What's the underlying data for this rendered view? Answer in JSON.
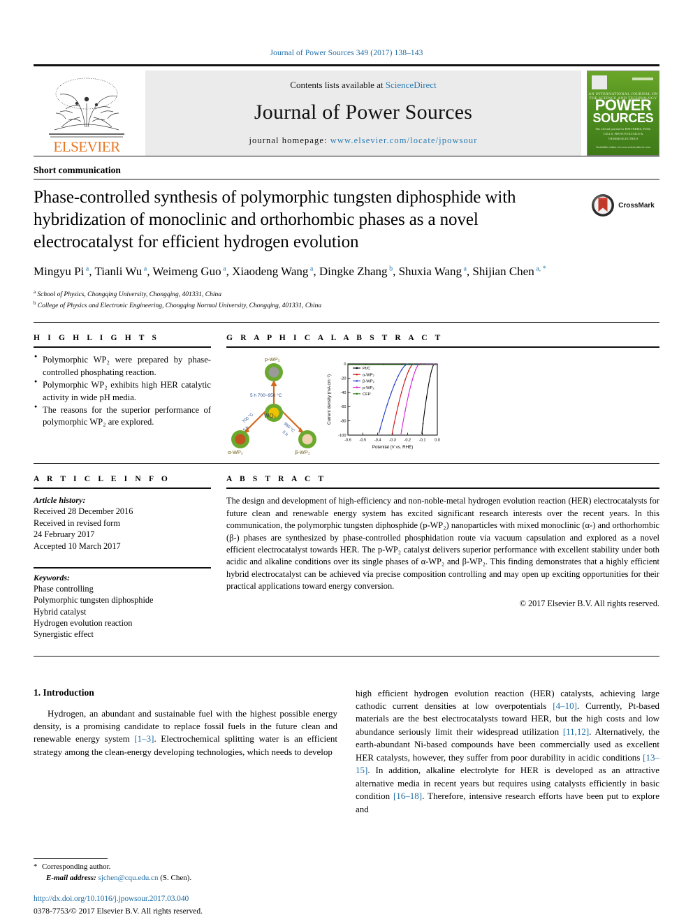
{
  "runhead": "Journal of Power Sources 349 (2017) 138–143",
  "masthead": {
    "contents_label": "Contents lists available at",
    "sciencedirect": "ScienceDirect",
    "journal_title": "Journal of Power Sources",
    "homepage_label": "journal homepage:",
    "homepage_url": "www.elsevier.com/locate/jpowsour",
    "publisher": "ELSEVIER",
    "cover": {
      "subtitle": "AN INTERNATIONAL JOURNAL ON THE SCIENCE AND TECHNOLOGY OF",
      "line1": "POWER",
      "line2": "SOURCES",
      "small": "The official journal for\nBATTERIES, FUEL CELLS, PHOTOVOLTAICS & THERMOELECTRICS",
      "bottom": "Available online at\nwww.sciencedirect.com"
    }
  },
  "article_type": "Short communication",
  "title": "Phase-controlled synthesis of polymorphic tungsten diphosphide with hybridization of monoclinic and orthorhombic phases as a novel electrocatalyst for efficient hydrogen evolution",
  "crossmark_label": "CrossMark",
  "authors": [
    {
      "name": "Mingyu Pi",
      "sup": "a",
      "sep": ", "
    },
    {
      "name": "Tianli Wu",
      "sup": "a",
      "sep": ", "
    },
    {
      "name": "Weimeng Guo",
      "sup": "a",
      "sep": ", "
    },
    {
      "name": "Xiaodeng Wang",
      "sup": "a",
      "sep": ", "
    },
    {
      "name": "Dingke Zhang",
      "sup": "b",
      "sep": ", "
    },
    {
      "name": "Shuxia Wang",
      "sup": "a",
      "sep": ", "
    },
    {
      "name": "Shijian Chen",
      "sup": "a, *",
      "sep": ""
    }
  ],
  "affiliations": [
    {
      "mark": "a",
      "text": "School of Physics, Chongqing University, Chongqing, 401331, China"
    },
    {
      "mark": "b",
      "text": "College of Physics and Electronic Engineering, Chongqing Normal University, Chongqing, 401331, China"
    }
  ],
  "highlights": {
    "heading": "H I G H L I G H T S",
    "items": [
      "Polymorphic WP₂ were prepared by phase-controlled phosphating reaction.",
      "Polymorphic WP₂ exhibits high HER catalytic activity in wide pH media.",
      "The reasons for the superior performance of polymorphic WP₂ are explored."
    ]
  },
  "graphical_abstract": {
    "heading": "G R A P H I C A L   A B S T R A C T",
    "diagram": {
      "center": "WO₃",
      "top_product": "p-WP₂",
      "left_product": "α-WP₂",
      "right_product": "β-WP₂",
      "top_condition": "5 h  700~950 °C",
      "left_condition": "700 °C",
      "left_time": "5 h",
      "right_condition": "950 °C",
      "right_time": "5 h"
    }
  },
  "chart_data": {
    "type": "line",
    "title": "",
    "xlabel": "Potential (V vs. RHE)",
    "ylabel": "Current density (mA cm⁻²)",
    "xlim": [
      -0.6,
      0.0
    ],
    "ylim": [
      -100,
      0
    ],
    "xticks": [
      "-0.6",
      "-0.5",
      "-0.4",
      "-0.3",
      "-0.2",
      "-0.1",
      "0.0"
    ],
    "yticks": [
      "0",
      "-20",
      "-40",
      "-60",
      "-80",
      "-100"
    ],
    "grid": false,
    "legend_position": "upper-left",
    "series": [
      {
        "name": "Pt/C",
        "color": "#000000",
        "onset": -0.02,
        "j100": -0.105
      },
      {
        "name": "α-WP₂",
        "color": "#cc1111",
        "onset": -0.16,
        "j100": -0.305
      },
      {
        "name": "β-WP₂",
        "color": "#1c39c4",
        "onset": -0.2,
        "j100": -0.395
      },
      {
        "name": "p-WP₂",
        "color": "#d81fd8",
        "onset": -0.12,
        "j100": -0.245
      },
      {
        "name": "CFP",
        "color": "#2d7a16",
        "onset": -0.6,
        "j100": 0.0
      }
    ]
  },
  "article_info": {
    "heading": "A R T I C L E   I N F O",
    "history_label": "Article history:",
    "history": [
      "Received 28 December 2016",
      "Received in revised form",
      "24 February 2017",
      "Accepted 10 March 2017"
    ],
    "keywords_label": "Keywords:",
    "keywords": [
      "Phase controlling",
      "Polymorphic tungsten diphosphide",
      "Hybrid catalyst",
      "Hydrogen evolution reaction",
      "Synergistic effect"
    ]
  },
  "abstract": {
    "heading": "A B S T R A C T",
    "text": "The design and development of high-efficiency and non-noble-metal hydrogen evolution reaction (HER) electrocatalysts for future clean and renewable energy system has excited significant research interests over the recent years. In this communication, the polymorphic tungsten diphosphide (p-WP₂) nanoparticles with mixed monoclinic (α-) and orthorhombic (β-) phases are synthesized by phase-controlled phosphidation route via vacuum capsulation and explored as a novel efficient electrocatalyst towards HER. The p-WP₂ catalyst delivers superior performance with excellent stability under both acidic and alkaline conditions over its single phases of α-WP₂ and β-WP₂. This finding demonstrates that a highly efficient hybrid electrocatalyst can be achieved via precise composition controlling and may open up exciting opportunities for their practical applications toward energy conversion.",
    "copyright": "© 2017 Elsevier B.V. All rights reserved."
  },
  "body": {
    "section_heading": "1.  Introduction",
    "left_paragraph_pre": "Hydrogen, an abundant and sustainable fuel with the highest possible energy density, is a promising candidate to replace fossil fuels in the future clean and renewable energy system ",
    "left_cite1": "[1–3]",
    "left_paragraph_post": ". Electrochemical splitting water is an efficient strategy among the clean-energy developing technologies, which needs to develop",
    "right_segments": [
      {
        "t": "high efficient hydrogen evolution reaction (HER) catalysts, achieving large cathodic current densities at low overpotentials ",
        "cite": false
      },
      {
        "t": "[4–10]",
        "cite": true
      },
      {
        "t": ". Currently, Pt-based materials are the best electrocatalysts toward HER, but the high costs and low abundance seriously limit their widespread utilization ",
        "cite": false
      },
      {
        "t": "[11,12]",
        "cite": true
      },
      {
        "t": ". Alternatively, the earth-abundant Ni-based compounds have been commercially used as excellent HER catalysts, however, they suffer from poor durability in acidic conditions ",
        "cite": false
      },
      {
        "t": "[13–15]",
        "cite": true
      },
      {
        "t": ". In addition, alkaline electrolyte for HER is developed as an attractive alternative media in recent years but requires using catalysts efficiently in basic condition ",
        "cite": false
      },
      {
        "t": "[16–18]",
        "cite": true
      },
      {
        "t": ". Therefore, intensive research efforts have been put to explore and",
        "cite": false
      }
    ]
  },
  "footer": {
    "corresponding": "Corresponding author.",
    "email_label": "E-mail address:",
    "email": "sjchen@cqu.edu.cn",
    "email_owner": "(S. Chen).",
    "doi": "http://dx.doi.org/10.1016/j.jpowsour.2017.03.040",
    "issn": "0378-7753/© 2017 Elsevier B.V. All rights reserved."
  }
}
